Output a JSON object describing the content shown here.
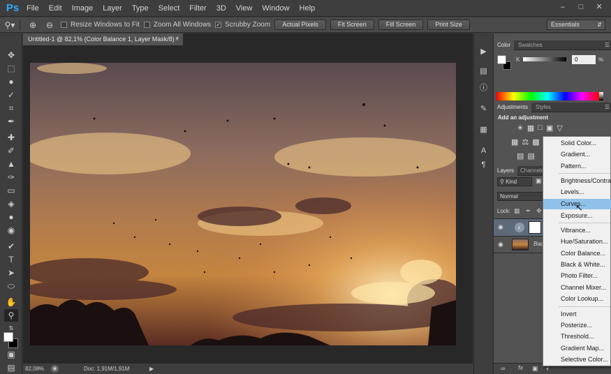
{
  "app": {
    "logo": "Ps"
  },
  "menubar": {
    "items": [
      "File",
      "Edit",
      "Image",
      "Layer",
      "Type",
      "Select",
      "Filter",
      "3D",
      "View",
      "Window",
      "Help"
    ],
    "window_controls": [
      "–",
      "□",
      "✕"
    ]
  },
  "options": {
    "checkboxes": [
      {
        "label": "Resize Windows to Fit",
        "checked": false
      },
      {
        "label": "Zoom All Windows",
        "checked": false
      },
      {
        "label": "Scrubby Zoom",
        "checked": true
      }
    ],
    "buttons": [
      "Actual Pixels",
      "Fit Screen",
      "Fill Screen",
      "Print Size"
    ],
    "workspace": "Essentials"
  },
  "document": {
    "tab_title": "Untitled-1 @ 82,1% (Color Balance 1, Layer Mask/8) *",
    "close": "×"
  },
  "status": {
    "zoom": "82,08%",
    "doc": "Doc: 1,91M/1,91M"
  },
  "color_panel": {
    "tabs": [
      "Color",
      "Swatches"
    ],
    "channel": "K",
    "value": "0",
    "unit": "%"
  },
  "adjustments_panel": {
    "tabs": [
      "Adjustments",
      "Styles"
    ],
    "heading": "Add an adjustment"
  },
  "layers_panel": {
    "tabs": [
      "Layers",
      "Channels"
    ],
    "filter": "Kind",
    "blend_mode": "Normal",
    "lock_label": "Lock:",
    "layers": [
      {
        "name": "",
        "visible": true
      },
      {
        "name": "Back",
        "visible": true
      }
    ]
  },
  "adjustment_menu": {
    "groups": [
      [
        "Solid Color...",
        "Gradient...",
        "Pattern..."
      ],
      [
        "Brightness/Contrast...",
        "Levels...",
        "Curves...",
        "Exposure..."
      ],
      [
        "Vibrance...",
        "Hue/Saturation...",
        "Color Balance...",
        "Black & White...",
        "Photo Filter...",
        "Channel Mixer...",
        "Color Lookup..."
      ],
      [
        "Invert",
        "Posterize...",
        "Threshold...",
        "Gradient Map...",
        "Selective Color..."
      ]
    ],
    "highlighted": "Curves..."
  },
  "colors": {
    "accent": "#30a8ff",
    "highlight": "#8fc1ea",
    "panel": "#535353",
    "chrome": "#3e3e3e"
  }
}
